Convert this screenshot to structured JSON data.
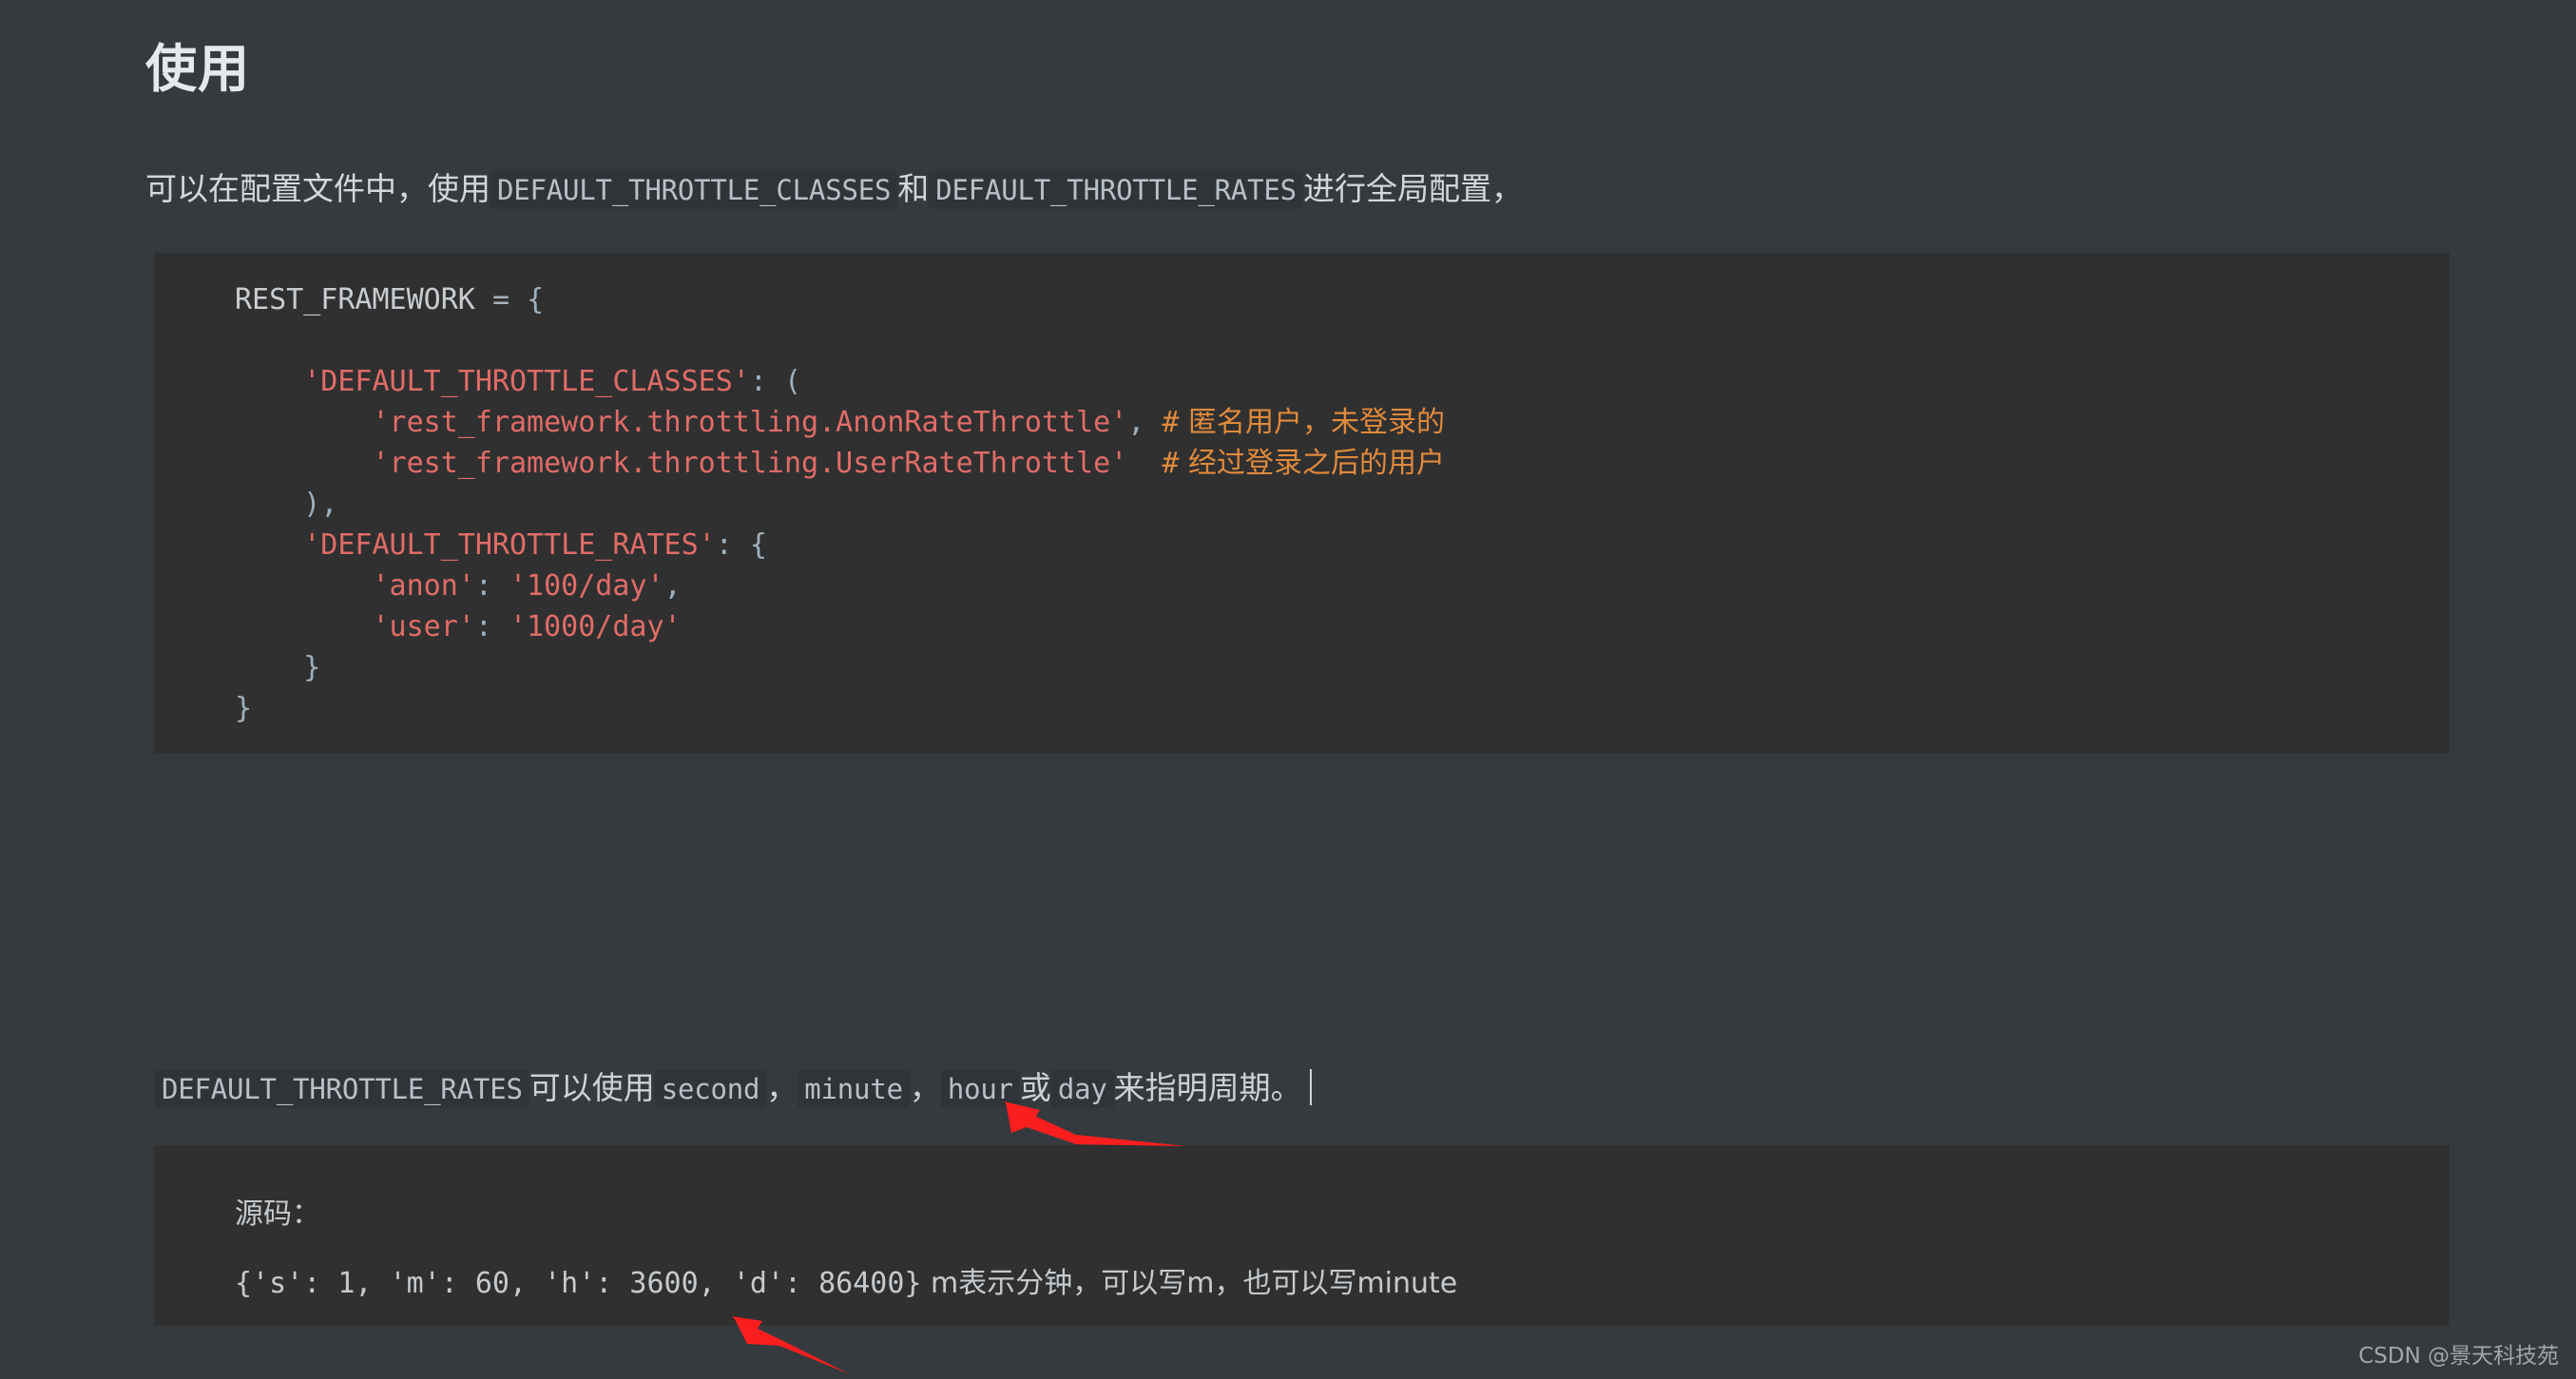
{
  "heading": "使用",
  "intro": {
    "before": "可以在配置文件中，使用",
    "code1": "DEFAULT_THROTTLE_CLASSES",
    "between": "和",
    "code2": "DEFAULT_THROTTLE_RATES",
    "after": "进行全局配置，"
  },
  "code_block": {
    "language": "python",
    "lines": [
      [
        {
          "t": "REST_FRAMEWORK",
          "c": "name"
        },
        {
          "t": " ",
          "c": "op"
        },
        {
          "t": "=",
          "c": "op"
        },
        {
          "t": " ",
          "c": "op"
        },
        {
          "t": "{",
          "c": "punc"
        }
      ],
      [
        {
          "t": "",
          "c": "name"
        }
      ],
      [
        {
          "t": "    ",
          "c": "op"
        },
        {
          "t": "'DEFAULT_THROTTLE_CLASSES'",
          "c": "str"
        },
        {
          "t": ":",
          "c": "punc"
        },
        {
          "t": " ",
          "c": "op"
        },
        {
          "t": "(",
          "c": "punc"
        }
      ],
      [
        {
          "t": "        ",
          "c": "op"
        },
        {
          "t": "'rest_framework.throttling.AnonRateThrottle'",
          "c": "str"
        },
        {
          "t": ",",
          "c": "punc"
        },
        {
          "t": " ",
          "c": "op"
        },
        {
          "t": "# 匿名用户，未登录的",
          "c": "comment"
        }
      ],
      [
        {
          "t": "        ",
          "c": "op"
        },
        {
          "t": "'rest_framework.throttling.UserRateThrottle'",
          "c": "str"
        },
        {
          "t": "  ",
          "c": "op"
        },
        {
          "t": "# 经过登录之后的用户",
          "c": "comment"
        }
      ],
      [
        {
          "t": "    ",
          "c": "op"
        },
        {
          "t": ")",
          "c": "punc"
        },
        {
          "t": ",",
          "c": "punc"
        }
      ],
      [
        {
          "t": "    ",
          "c": "op"
        },
        {
          "t": "'DEFAULT_THROTTLE_RATES'",
          "c": "str"
        },
        {
          "t": ":",
          "c": "punc"
        },
        {
          "t": " ",
          "c": "op"
        },
        {
          "t": "{",
          "c": "punc"
        }
      ],
      [
        {
          "t": "        ",
          "c": "op"
        },
        {
          "t": "'anon'",
          "c": "str"
        },
        {
          "t": ":",
          "c": "punc"
        },
        {
          "t": " ",
          "c": "op"
        },
        {
          "t": "'100/day'",
          "c": "str"
        },
        {
          "t": ",",
          "c": "punc"
        }
      ],
      [
        {
          "t": "        ",
          "c": "op"
        },
        {
          "t": "'user'",
          "c": "str"
        },
        {
          "t": ":",
          "c": "punc"
        },
        {
          "t": " ",
          "c": "op"
        },
        {
          "t": "'1000/day'",
          "c": "str"
        }
      ],
      [
        {
          "t": "    ",
          "c": "op"
        },
        {
          "t": "}",
          "c": "punc"
        }
      ],
      [
        {
          "t": "}",
          "c": "punc"
        }
      ]
    ]
  },
  "mid_paragraph": {
    "code1": "DEFAULT_THROTTLE_RATES",
    "text1": "可以使用",
    "code2": "second",
    "sep1": "，",
    "code3": "minute",
    "sep2": "，",
    "code4": "hour",
    "text2": "或",
    "code5": "day",
    "text3": "来指明周期。"
  },
  "code_block_2": {
    "line1": "源码：",
    "line2_code": "{'s': 1, 'm': 60, 'h': 3600, 'd': 86400}",
    "line2_note": " m表示分钟，可以写m，也可以写minute"
  },
  "annotations": {
    "arrow_color": "#fa1e1e",
    "arrow1": "red-arrow-pointing-to-minute",
    "arrow2": "red-arrow-pointing-to-m-key"
  },
  "watermark": "CSDN @景天科技苑",
  "colors": {
    "page_bg": "#353a3e",
    "code_bg": "#303030",
    "inline_code_bg": "#2f3438",
    "string": "#e06c68",
    "comment": "#e08a3c",
    "text": "#d4d8dc"
  }
}
